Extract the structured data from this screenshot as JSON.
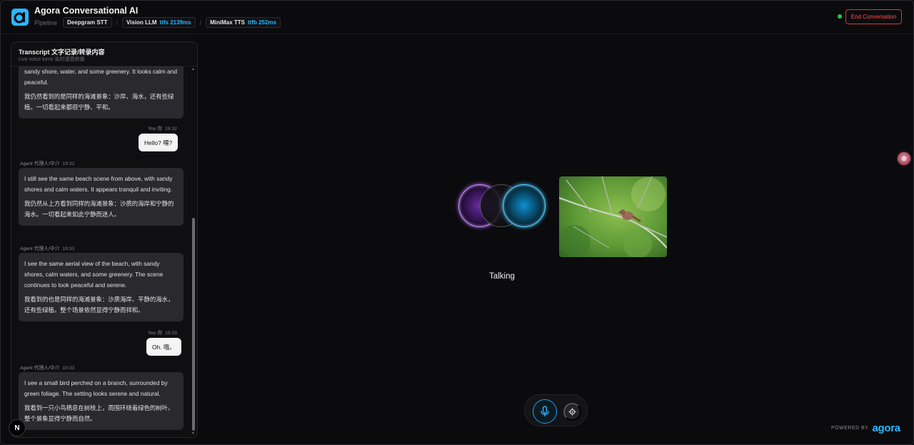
{
  "header": {
    "title": "Agora Conversational AI",
    "pipeline_label": "Pipeline",
    "chips": [
      {
        "name": "Deepgram STT",
        "metric": ""
      },
      {
        "name": "Vision LLM",
        "metric": "ttfs 2139ms"
      },
      {
        "name": "MiniMax TTS",
        "metric": "ttfb 252ms"
      }
    ],
    "separator": "/",
    "end_button": "End Conversation"
  },
  "transcript": {
    "title": "Transcript 文字记录/转录内容",
    "subtitle": "Live voice turns 实时语音转换",
    "messages": [
      {
        "role": "agent",
        "en": "sandy shore, water, and some greenery. It looks calm and peaceful.",
        "zh": "我仍然看到的是同样的海滩景象：沙岸、海水，还有些绿植。一切看起来都很宁静、平和。"
      },
      {
        "role": "user",
        "label": "You 你",
        "time": "19:32",
        "text": "Hello? 喂?"
      },
      {
        "role": "agent",
        "label": "Agent 代理人/中介",
        "time": "19:32",
        "en": "I still see the same beach scene from above, with sandy shores and calm waters. It appears tranquil and inviting.",
        "zh": "我仍然从上方看到同样的海滩景象：沙质的海岸和宁静的海水。一切看起来如此宁静而迷人。"
      },
      {
        "role": "agent",
        "label": "Agent 代理人/中介",
        "time": "19:33",
        "en": "I see the same aerial view of the beach, with sandy shores, calm waters, and some greenery. The scene continues to look peaceful and serene.",
        "zh": "我看到的也是同样的海滩景象：沙质海岸、平静的海水，还有些绿植。整个场景依然显得宁静而祥和。"
      },
      {
        "role": "user",
        "label": "You 你",
        "time": "19:33",
        "text": "Oh. 哦。"
      },
      {
        "role": "agent",
        "label": "Agent 代理人/中介",
        "time": "19:33",
        "en": "I see a small bird perched on a branch, surrounded by green foliage. The setting looks serene and natural.",
        "zh": "我看到一只小鸟栖息在树枝上，周围环绕着绿色的树叶。整个景象显得宁静而自然。"
      }
    ]
  },
  "status": {
    "state_label": "Talking"
  },
  "footer": {
    "powered_by": "POWERED BY",
    "brand": "agora"
  },
  "badge": {
    "letter": "N"
  },
  "icons": {
    "logo": "agora-logo-icon",
    "mic": "microphone-icon",
    "settings": "gear-icon",
    "avatar": "floating-avatar-icon",
    "status": "connection-status-dot"
  },
  "colors": {
    "accent": "#2ab7ff",
    "danger": "#ff5252",
    "online": "#28c840",
    "background": "#0b0b0d"
  }
}
